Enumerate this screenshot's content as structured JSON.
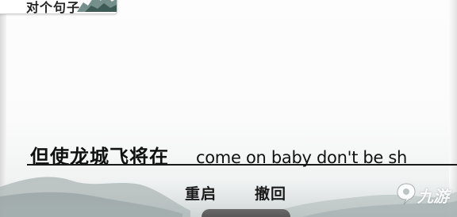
{
  "header": {
    "title": "对个句子"
  },
  "sentence": {
    "chinese": "但使龙城飞将在",
    "english": "come on baby don't be sh"
  },
  "controls": {
    "restart_label": "重启",
    "undo_label": "撤回"
  },
  "watermark": {
    "text": "九游",
    "icon": "jiuyou-logo-icon"
  },
  "colors": {
    "text": "#111111",
    "ink_wash": "#9aa6a6",
    "background": "#fbfbfb"
  }
}
